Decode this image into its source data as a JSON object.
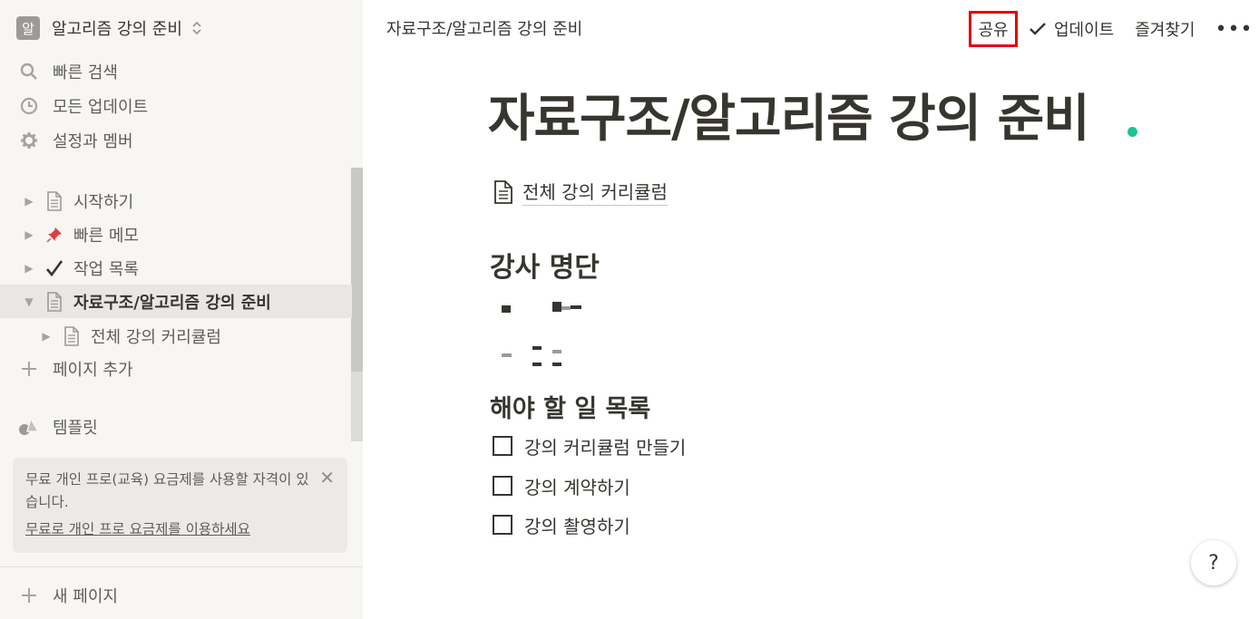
{
  "workspace": {
    "avatar_letter": "알",
    "name": "알고리즘 강의 준비"
  },
  "nav": {
    "search": "빠른 검색",
    "updates": "모든 업데이트",
    "settings": "설정과 멤버"
  },
  "tree": [
    {
      "label": "시작하기",
      "icon": "page-icon"
    },
    {
      "label": "빠른 메모",
      "icon": "pushpin-icon"
    },
    {
      "label": "작업 목록",
      "icon": "checkmark-icon"
    },
    {
      "label": "자료구조/알고리즘 강의 준비",
      "icon": "page-icon",
      "active": true
    },
    {
      "label": "전체 강의 커리큘럼",
      "icon": "page-icon"
    }
  ],
  "sidebar": {
    "add_page": "페이지 추가",
    "templates": "템플릿",
    "new_page": "새 페이지"
  },
  "promo": {
    "text": "무료 개인 프로(교육) 요금제를 사용할 자격이 있습니다.",
    "link": "무료로 개인 프로 요금제를 이용하세요",
    "close": "✕"
  },
  "topbar": {
    "breadcrumb": "자료구조/알고리즘 강의 준비",
    "share": "공유",
    "updates": "업데이트",
    "favorites": "즐겨찾기",
    "more": "•••"
  },
  "page": {
    "title": "자료구조/알고리즘 강의 준비",
    "subpage_link": "전체 강의 커리큘럼",
    "instructors_heading": "강사 명단",
    "todo_heading": "해야 할 일 목록",
    "todos": [
      "강의 커리큘럼 만들기",
      "강의 계약하기",
      "강의 촬영하기"
    ]
  },
  "help": "?",
  "colors": {
    "accent": "#e3000f",
    "caret": "#1fc292",
    "sidebar_bg": "#f7f6f3",
    "text": "#37352f"
  }
}
